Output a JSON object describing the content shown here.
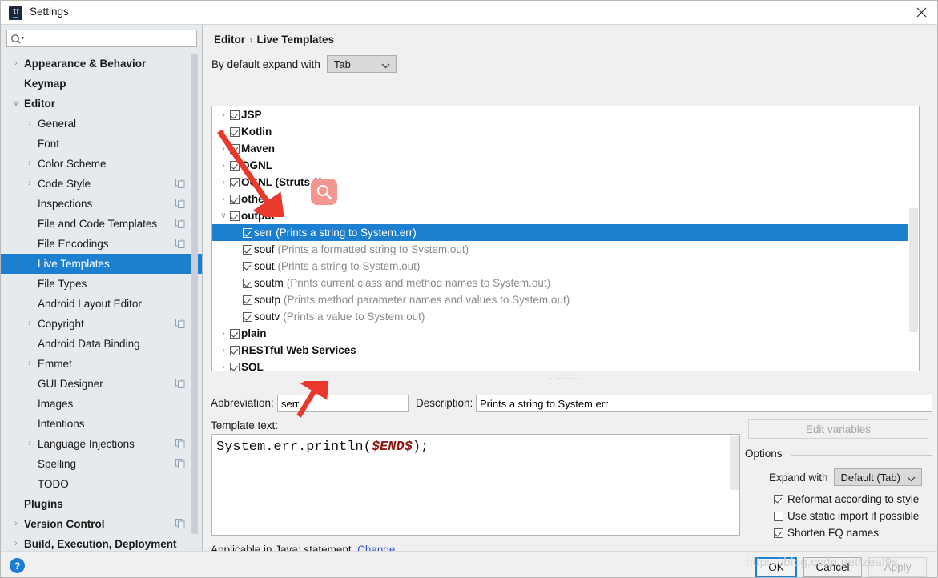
{
  "window": {
    "title": "Settings",
    "app_icon": "intellij-idea-icon",
    "close_icon": "close-icon"
  },
  "search": {
    "placeholder": "",
    "value": "",
    "icon": "search-icon"
  },
  "sidebar": {
    "items": [
      {
        "label": "Appearance & Behavior",
        "level": 0,
        "bold": true,
        "chevron": "›",
        "copy": false,
        "selected": false
      },
      {
        "label": "Keymap",
        "level": 0,
        "bold": true,
        "chevron": "",
        "copy": false,
        "selected": false
      },
      {
        "label": "Editor",
        "level": 0,
        "bold": true,
        "chevron": "⌄",
        "copy": false,
        "selected": false
      },
      {
        "label": "General",
        "level": 1,
        "bold": false,
        "chevron": "›",
        "copy": false,
        "selected": false
      },
      {
        "label": "Font",
        "level": 1,
        "bold": false,
        "chevron": "",
        "copy": false,
        "selected": false
      },
      {
        "label": "Color Scheme",
        "level": 1,
        "bold": false,
        "chevron": "›",
        "copy": false,
        "selected": false
      },
      {
        "label": "Code Style",
        "level": 1,
        "bold": false,
        "chevron": "›",
        "copy": true,
        "selected": false
      },
      {
        "label": "Inspections",
        "level": 1,
        "bold": false,
        "chevron": "",
        "copy": true,
        "selected": false
      },
      {
        "label": "File and Code Templates",
        "level": 1,
        "bold": false,
        "chevron": "",
        "copy": true,
        "selected": false
      },
      {
        "label": "File Encodings",
        "level": 1,
        "bold": false,
        "chevron": "",
        "copy": true,
        "selected": false
      },
      {
        "label": "Live Templates",
        "level": 1,
        "bold": false,
        "chevron": "",
        "copy": false,
        "selected": true
      },
      {
        "label": "File Types",
        "level": 1,
        "bold": false,
        "chevron": "",
        "copy": false,
        "selected": false
      },
      {
        "label": "Android Layout Editor",
        "level": 1,
        "bold": false,
        "chevron": "",
        "copy": false,
        "selected": false
      },
      {
        "label": "Copyright",
        "level": 1,
        "bold": false,
        "chevron": "›",
        "copy": true,
        "selected": false
      },
      {
        "label": "Android Data Binding",
        "level": 1,
        "bold": false,
        "chevron": "",
        "copy": false,
        "selected": false
      },
      {
        "label": "Emmet",
        "level": 1,
        "bold": false,
        "chevron": "›",
        "copy": false,
        "selected": false
      },
      {
        "label": "GUI Designer",
        "level": 1,
        "bold": false,
        "chevron": "",
        "copy": true,
        "selected": false
      },
      {
        "label": "Images",
        "level": 1,
        "bold": false,
        "chevron": "",
        "copy": false,
        "selected": false
      },
      {
        "label": "Intentions",
        "level": 1,
        "bold": false,
        "chevron": "",
        "copy": false,
        "selected": false
      },
      {
        "label": "Language Injections",
        "level": 1,
        "bold": false,
        "chevron": "›",
        "copy": true,
        "selected": false
      },
      {
        "label": "Spelling",
        "level": 1,
        "bold": false,
        "chevron": "",
        "copy": true,
        "selected": false
      },
      {
        "label": "TODO",
        "level": 1,
        "bold": false,
        "chevron": "",
        "copy": false,
        "selected": false
      },
      {
        "label": "Plugins",
        "level": 0,
        "bold": true,
        "chevron": "",
        "copy": false,
        "selected": false
      },
      {
        "label": "Version Control",
        "level": 0,
        "bold": true,
        "chevron": "›",
        "copy": true,
        "selected": false
      },
      {
        "label": "Build, Execution, Deployment",
        "level": 0,
        "bold": true,
        "chevron": "›",
        "copy": false,
        "selected": false
      }
    ]
  },
  "main": {
    "breadcrumb_root": "Editor",
    "breadcrumb_sep": "›",
    "breadcrumb_leaf": "Live Templates",
    "expand_label": "By default expand with",
    "expand_value": "Tab",
    "expand_options": [
      "Tab"
    ],
    "tree_rows": [
      {
        "name": "JSP",
        "desc": "",
        "chevron": "›",
        "checked": true,
        "child": false,
        "selected": false
      },
      {
        "name": "Kotlin",
        "desc": "",
        "chevron": "›",
        "checked": true,
        "child": false,
        "selected": false
      },
      {
        "name": "Maven",
        "desc": "",
        "chevron": "›",
        "checked": true,
        "child": false,
        "selected": false
      },
      {
        "name": "OGNL",
        "desc": "",
        "chevron": "›",
        "checked": true,
        "child": false,
        "selected": false
      },
      {
        "name": "OGNL (Struts 2)",
        "desc": "",
        "chevron": "›",
        "checked": true,
        "child": false,
        "selected": false
      },
      {
        "name": "other",
        "desc": "",
        "chevron": "›",
        "checked": true,
        "child": false,
        "selected": false
      },
      {
        "name": "output",
        "desc": "",
        "chevron": "⌄",
        "checked": true,
        "child": false,
        "selected": false
      },
      {
        "name": "serr",
        "desc": "(Prints a string to System.err)",
        "chevron": "",
        "checked": true,
        "child": true,
        "selected": true
      },
      {
        "name": "souf",
        "desc": "(Prints a formatted string to System.out)",
        "chevron": "",
        "checked": true,
        "child": true,
        "selected": false
      },
      {
        "name": "sout",
        "desc": "(Prints a string to System.out)",
        "chevron": "",
        "checked": true,
        "child": true,
        "selected": false
      },
      {
        "name": "soutm",
        "desc": "(Prints current class and method names to System.out)",
        "chevron": "",
        "checked": true,
        "child": true,
        "selected": false
      },
      {
        "name": "soutp",
        "desc": "(Prints method parameter names and values to System.out)",
        "chevron": "",
        "checked": true,
        "child": true,
        "selected": false
      },
      {
        "name": "soutv",
        "desc": "(Prints a value to System.out)",
        "chevron": "",
        "checked": true,
        "child": true,
        "selected": false
      },
      {
        "name": "plain",
        "desc": "",
        "chevron": "›",
        "checked": true,
        "child": false,
        "selected": false
      },
      {
        "name": "RESTful Web Services",
        "desc": "",
        "chevron": "›",
        "checked": true,
        "child": false,
        "selected": false
      },
      {
        "name": "SQL",
        "desc": "",
        "chevron": "›",
        "checked": true,
        "child": false,
        "selected": false
      }
    ],
    "toolbar": [
      {
        "icon": "plus-icon",
        "name": "add-template-button"
      },
      {
        "icon": "minus-icon",
        "name": "remove-template-button"
      },
      {
        "icon": "duplicate-icon",
        "name": "duplicate-template-button"
      },
      {
        "icon": "copy-to-group-icon",
        "name": "move-template-button"
      }
    ],
    "abbreviation_label": "Abbreviation:",
    "abbreviation_value": "serr",
    "description_label": "Description:",
    "description_value": "Prints a string to System.err",
    "template_text_label": "Template text:",
    "template_code_prefix": "System.err.println(",
    "template_code_variable": "$END$",
    "template_code_suffix": ");",
    "edit_variables_label": "Edit variables",
    "applicable_text": "Applicable in Java: statement.",
    "applicable_link": "Change"
  },
  "options": {
    "title": "Options",
    "expand_with_label": "Expand with",
    "expand_with_value": "Default (Tab)",
    "expand_with_options": [
      "Default (Tab)"
    ],
    "checkboxes": [
      {
        "label": "Reformat according to style",
        "checked": true
      },
      {
        "label": "Use static import if possible",
        "checked": false
      },
      {
        "label": "Shorten FQ names",
        "checked": true
      }
    ]
  },
  "footer": {
    "help_label": "?",
    "ok_label": "OK",
    "cancel_label": "Cancel",
    "apply_label": "Apply"
  },
  "overlay": {
    "watermark": "https://blog.csdn.net/zeal9s"
  },
  "colors": {
    "selection_blue": "#1d7fd0",
    "sidebar_bg": "#e6eaed",
    "panel_bg": "#f0f0f0",
    "annotation_red": "#e8392c",
    "link_blue": "#2a4fd9",
    "variable_red": "#8b1a15"
  }
}
